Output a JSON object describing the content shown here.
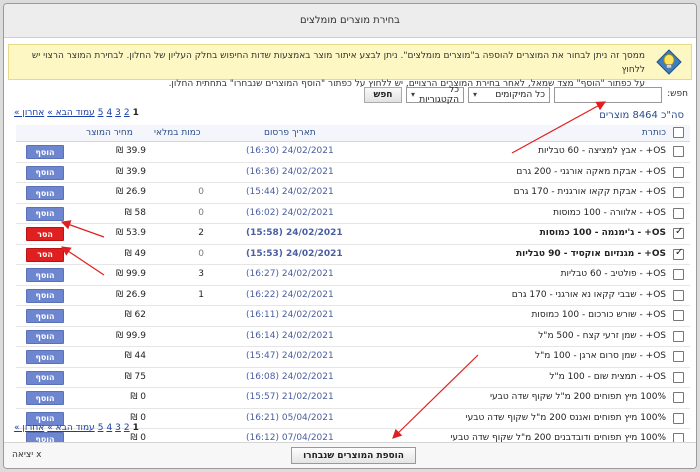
{
  "dialog": {
    "title": "בחירת מוצרים מומלצים"
  },
  "notice": {
    "line1": "ממסך זה ניתן לבחור את המוצרים להוספה ב\"מוצרים מומלצים\". ניתן לבצע איתור מוצר באמצעות שדות החיפוש בחלק העליון של החלון. לבחירת המוצר הרצוי יש ללחוץ",
    "line2": "על כפתור \"הוסף\" מצד שמאל, לאחר בחירת המוצרים הרצויים, יש ללחוץ על כפתור \"הוסף המוצרים שנבחרו\" בתחתית החלון."
  },
  "search": {
    "label": "חפש:",
    "value": "",
    "locations_select": "כל המיקומים",
    "categories_select": "כל הקטגוריות",
    "button_label": "חפש"
  },
  "total_label": "סה\"כ 8464 מוצרים",
  "pager": {
    "last": "אחרון »",
    "next": "עמוד הבא »",
    "pages": [
      "5",
      "4",
      "3",
      "2"
    ],
    "current": "1"
  },
  "table": {
    "headers": {
      "title": "כותרת",
      "date": "תאריך פרסום",
      "qty": "כמות במלאי",
      "price": "מחיר המוצר"
    },
    "rows": [
      {
        "name": "OS+ - אבץ למציצה - 60 טבליות",
        "date": "24/02/2021",
        "time": "(16:30)",
        "qty": "",
        "price": "39.9 ₪",
        "action": "הוסף",
        "checked": false,
        "bold": false
      },
      {
        "name": "OS+ - אבקת מאקה אורגני - 200 גרם",
        "date": "24/02/2021",
        "time": "(16:36)",
        "qty": "",
        "price": "39.9 ₪",
        "action": "הוסף",
        "checked": false,
        "bold": false
      },
      {
        "name": "OS+ - אבקת קקאו אורגנית - 170 גרם",
        "date": "24/02/2021",
        "time": "(15:44)",
        "qty": "0",
        "price": "26.9 ₪",
        "action": "הוסף",
        "checked": false,
        "bold": false
      },
      {
        "name": "OS+ - אלוורה - 100 כמוסות",
        "date": "24/02/2021",
        "time": "(16:02)",
        "qty": "0",
        "price": "58 ₪",
        "action": "הוסף",
        "checked": false,
        "bold": false
      },
      {
        "name": "OS+ - ג'ימנמה - 100 כמוסות",
        "date": "24/02/2021",
        "time": "(15:58)",
        "qty": "2",
        "price": "53.9 ₪",
        "action": "הסר",
        "checked": true,
        "bold": true
      },
      {
        "name": "OS+ - מגנזיום אוקסיד - 90 טבליות",
        "date": "24/02/2021",
        "time": "(15:53)",
        "qty": "0",
        "price": "49 ₪",
        "action": "הסר",
        "checked": true,
        "bold": true
      },
      {
        "name": "OS+ - פולטיב - 60 טבליות",
        "date": "24/02/2021",
        "time": "(16:27)",
        "qty": "3",
        "price": "99.9 ₪",
        "action": "הוסף",
        "checked": false,
        "bold": false
      },
      {
        "name": "OS+ - שבבי קקאו נא אורגני - 170 גרם",
        "date": "24/02/2021",
        "time": "(16:22)",
        "qty": "1",
        "price": "26.9 ₪",
        "action": "הוסף",
        "checked": false,
        "bold": false
      },
      {
        "name": "OS+ - שורש כורכום - 100 כמוסות",
        "date": "24/02/2021",
        "time": "(16:11)",
        "qty": "",
        "price": "62 ₪",
        "action": "הוסף",
        "checked": false,
        "bold": false
      },
      {
        "name": "OS+ - שמן זרעי קצח - 500 מ\"ל",
        "date": "24/02/2021",
        "time": "(16:14)",
        "qty": "",
        "price": "99.9 ₪",
        "action": "הוסף",
        "checked": false,
        "bold": false
      },
      {
        "name": "OS+ - שמן סרום ארגן - 100 מ\"ל",
        "date": "24/02/2021",
        "time": "(15:47)",
        "qty": "",
        "price": "44 ₪",
        "action": "הוסף",
        "checked": false,
        "bold": false
      },
      {
        "name": "OS+ - תמצית שום - 100 מ\"ל",
        "date": "24/02/2021",
        "time": "(16:08)",
        "qty": "",
        "price": "75 ₪",
        "action": "הוסף",
        "checked": false,
        "bold": false
      },
      {
        "name": "100% מיץ תפוחים 200 מ\"ל שקוף שדה טבעי",
        "date": "21/02/2021",
        "time": "(15:57)",
        "qty": "",
        "price": "0 ₪",
        "action": "הוסף",
        "checked": false,
        "bold": false
      },
      {
        "name": "100% מיץ תפוחים ואננס 200 מ\"ל שקוף שדה טבעי",
        "date": "05/04/2021",
        "time": "(16:21)",
        "qty": "",
        "price": "0 ₪",
        "action": "הוסף",
        "checked": false,
        "bold": false
      },
      {
        "name": "100% מיץ תפוחים ודובדבנים 200 מ\"ל שקוף שדה טבעי",
        "date": "07/04/2021",
        "time": "(16:12)",
        "qty": "",
        "price": "0 ₪",
        "action": "הוסף",
        "checked": false,
        "bold": false
      }
    ]
  },
  "footer": {
    "submit_label": "הוספת המוצרים שנבחרו",
    "exit_label": "x יציאה"
  },
  "colors": {
    "add_button": "#6d86cf",
    "remove_button": "#e02020",
    "annotation_arrow": "#e02020",
    "notice_bg": "#fdf7c4"
  }
}
